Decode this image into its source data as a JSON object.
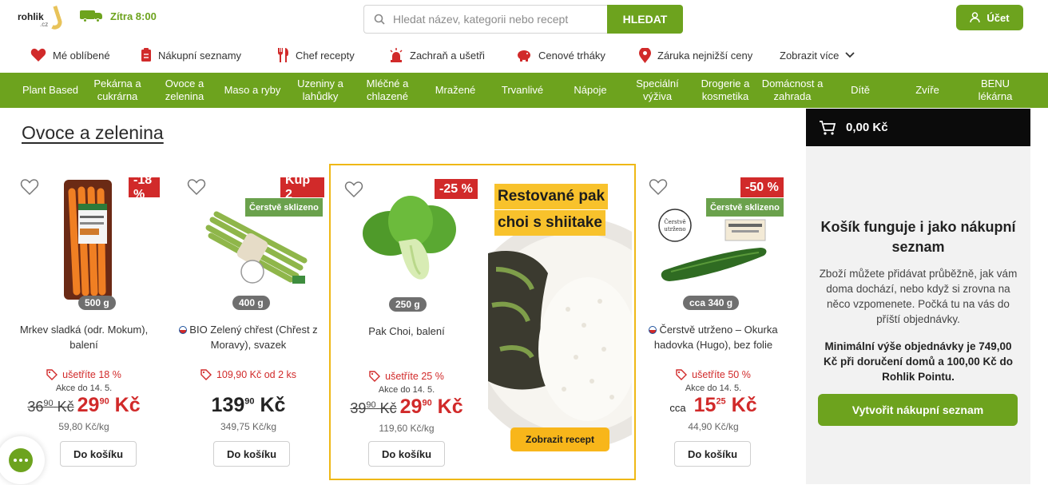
{
  "header": {
    "logo_text": "rohlik",
    "logo_suffix": ".cz",
    "delivery": "Zítra 8:00",
    "search_placeholder": "Hledat název, kategorii nebo recept",
    "search_button": "HLEDAT",
    "account": "Účet"
  },
  "quick_links": [
    "Mé oblíbené",
    "Nákupní seznamy",
    "Chef recepty",
    "Zachraň a ušetři",
    "Cenové trháky",
    "Záruka nejnižší ceny",
    "Zobrazit více"
  ],
  "categories": [
    "Plant Based",
    "Pekárna a cukrárna",
    "Ovoce a zelenina",
    "Maso a ryby",
    "Uzeniny a lahůdky",
    "Mléčné a chlazené",
    "Mražené",
    "Trvanlivé",
    "Nápoje",
    "Speciální výživa",
    "Drogerie a kosmetika",
    "Domácnost a zahrada",
    "Dítě",
    "Zvíře",
    "BENU lékárna"
  ],
  "page_title": "Ovoce a zelenina",
  "colors": {
    "brand": "#6da31e",
    "discount": "#d12a2a",
    "fresh": "#6aa14c",
    "featured": "#efb816"
  },
  "products": [
    {
      "badge": "-18 %",
      "fresh": "",
      "weight": "500 g",
      "flag": false,
      "name": "Mrkev sladká (odr. Mokum), balení",
      "promo": "ušetříte 18 %",
      "until": "Akce do 14. 5.",
      "old_int": "36",
      "old_dec": "90",
      "old_cur": "Kč",
      "prefix": "",
      "price_int": "29",
      "price_dec": "90",
      "price_cur": "Kč",
      "unit_price": "59,80 Kč/kg",
      "add": "Do košíku"
    },
    {
      "badge": "Kup 2",
      "fresh": "Čerstvě sklizeno",
      "weight": "400 g",
      "flag": true,
      "name": "BIO Zelený chřest (Chřest z Moravy), svazek",
      "promo": "109,90 Kč od 2 ks",
      "until": "",
      "old_int": "",
      "old_dec": "",
      "old_cur": "",
      "prefix": "",
      "price_int": "139",
      "price_dec": "90",
      "price_cur": "Kč",
      "unit_price": "349,75 Kč/kg",
      "add": "Do košíku"
    },
    {
      "badge": "-25 %",
      "fresh": "",
      "weight": "250 g",
      "flag": false,
      "name": "Pak Choi, balení",
      "promo": "ušetříte 25 %",
      "until": "Akce do 14. 5.",
      "old_int": "39",
      "old_dec": "90",
      "old_cur": "Kč",
      "prefix": "",
      "price_int": "29",
      "price_dec": "90",
      "price_cur": "Kč",
      "unit_price": "119,60 Kč/kg",
      "add": "Do košíku"
    },
    {
      "badge": "-50 %",
      "fresh": "Čerstvě sklizeno",
      "weight": "cca 340 g",
      "flag": true,
      "name": "Čerstvě utrženo – Okurka hadovka (Hugo), bez folie",
      "promo": "ušetříte 50 %",
      "until": "Akce do 14. 5.",
      "old_int": "",
      "old_dec": "",
      "old_cur": "",
      "prefix": "cca",
      "price_int": "15",
      "price_dec": "25",
      "price_cur": "Kč",
      "unit_price": "44,90 Kč/kg",
      "add": "Do košíku"
    }
  ],
  "recipe": {
    "title_line1": "Restované pak",
    "title_line2": "choi s shiitake",
    "button": "Zobrazit recept"
  },
  "cart": {
    "total": "0,00 Kč",
    "heading": "Košík funguje i jako nákupní seznam",
    "text": "Zboží můžete přidávat průběžně, jak vám doma dochází, nebo když si zrovna na něco vzpomenete. Počká tu na vás do příští objednávky.",
    "minimum": "Minimální výše objednávky je 749,00 Kč při doručení domů a 100,00 Kč do Rohlik Pointu.",
    "button": "Vytvořit nákupní seznam"
  }
}
